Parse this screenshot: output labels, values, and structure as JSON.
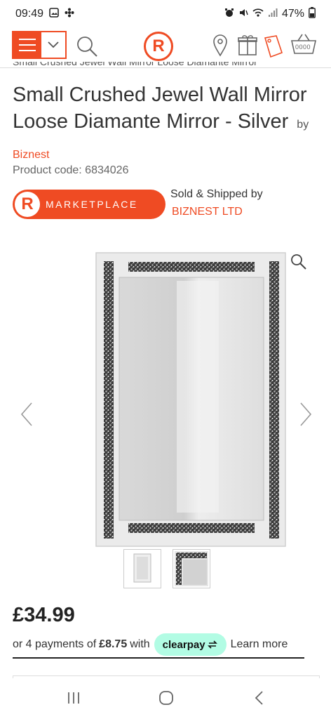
{
  "status_bar": {
    "time": "09:49",
    "battery": "47%"
  },
  "header": {
    "menu_icon": "hamburger-icon",
    "dropdown_icon": "chevron-down-icon",
    "search_icon": "search-icon",
    "logo_letter": "R",
    "store_icon": "location-pin-icon",
    "gift_icon": "gift-icon",
    "tag_icon": "price-tag-icon",
    "basket_icon": "basket-icon",
    "basket_count": "0000",
    "brand_color": "#ef4b23"
  },
  "breadcrumb": "Small Crushed Jewel Wall Mirror Loose Diamante Mirror",
  "product": {
    "title": "Small Crushed Jewel Wall Mirror Loose Diamante Mirror - Silver",
    "by_label": "by",
    "brand": "Biznest",
    "code_label": "Product code: 6834026"
  },
  "marketplace": {
    "badge_letter": "R",
    "badge_text": "MARKETPLACE",
    "sold_label": "Sold & Shipped by",
    "seller": "BIZNEST LTD"
  },
  "gallery": {
    "zoom_icon": "magnifier-icon",
    "prev_icon": "chevron-left-icon",
    "next_icon": "chevron-right-icon"
  },
  "pricing": {
    "price": "£34.99",
    "instalment_prefix": "or 4 payments of",
    "instalment_amount": "£8.75",
    "instalment_suffix": "with",
    "clearpay_label": "clearpay",
    "learn_more": "Learn more",
    "clearpay_color": "#b2fce4"
  },
  "system_nav": {
    "recents_icon": "recents-icon",
    "home_icon": "home-icon",
    "back_icon": "back-icon"
  }
}
